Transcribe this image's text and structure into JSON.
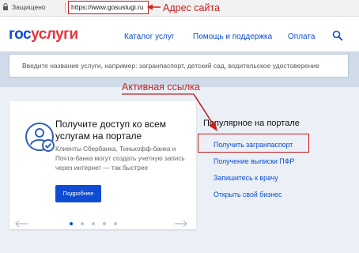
{
  "browser": {
    "secure_label": "Защищено",
    "url": "https://www.gosuslugi.ru"
  },
  "annotations": {
    "address_label": "Адрес сайта",
    "active_link_label": "Активная ссылка",
    "color": "#c62020"
  },
  "header": {
    "logo_part1": "гос",
    "logo_part2": "услуги",
    "nav": {
      "catalog": "Каталог услуг",
      "help": "Помощь и поддержка",
      "payment": "Оплата"
    }
  },
  "search": {
    "placeholder": "Введите название услуги, например: загранпаспорт, детский сад, водительское удостоверение"
  },
  "promo": {
    "title": "Получите доступ ко всем услугам на портале",
    "text": "Клиенты Сбербанка, Тинькофф-банка и Почта-банка могут создать учетную запись через интернет — так быстрее",
    "button": "Подробнее"
  },
  "popular": {
    "title": "Популярное на портале",
    "links": [
      "Получить загранпаспорт",
      "Получение выписки ПФР",
      "Запишитесь к врачу",
      "Открыть свой бизнес"
    ]
  },
  "colors": {
    "brand_blue": "#0d4cd3",
    "brand_red": "#e5343d"
  }
}
